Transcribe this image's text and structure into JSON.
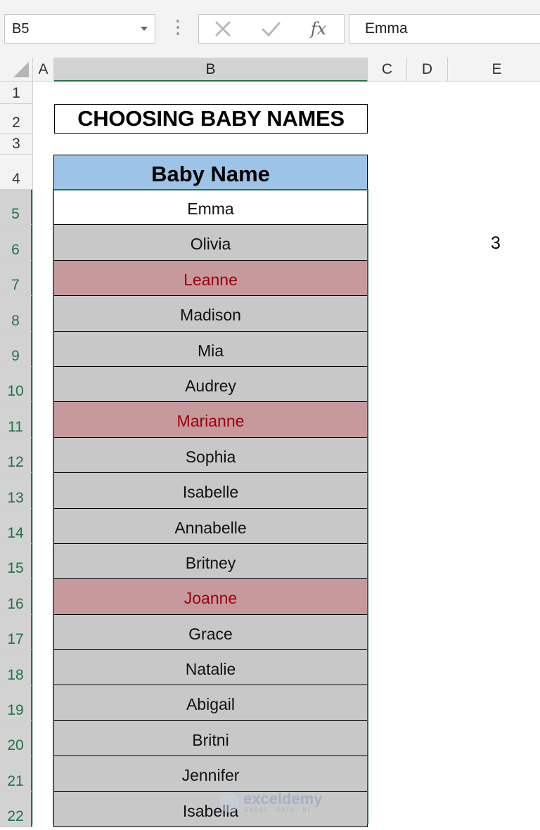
{
  "formula_bar": {
    "name_box": "B5",
    "cancel_symbol": "✕",
    "enter_symbol": "✓",
    "fx_label": "fx",
    "value": "Emma"
  },
  "columns": [
    "A",
    "B",
    "C",
    "D",
    "E"
  ],
  "rows": [
    "1",
    "2",
    "3",
    "4",
    "5",
    "6",
    "7",
    "8",
    "9",
    "10",
    "11",
    "12",
    "13",
    "14",
    "15",
    "16",
    "17",
    "18",
    "19",
    "20",
    "21",
    "22"
  ],
  "sheet": {
    "title": "CHOOSING BABY NAMES",
    "header": "Baby Name",
    "names": [
      {
        "name": "Emma",
        "duplicate": false,
        "active": true
      },
      {
        "name": "Olivia",
        "duplicate": false
      },
      {
        "name": "Leanne",
        "duplicate": true
      },
      {
        "name": "Madison",
        "duplicate": false
      },
      {
        "name": "Mia",
        "duplicate": false
      },
      {
        "name": "Audrey",
        "duplicate": false
      },
      {
        "name": "Marianne",
        "duplicate": true
      },
      {
        "name": "Sophia",
        "duplicate": false
      },
      {
        "name": "Isabelle",
        "duplicate": false
      },
      {
        "name": "Annabelle",
        "duplicate": false
      },
      {
        "name": "Britney",
        "duplicate": false
      },
      {
        "name": "Joanne",
        "duplicate": true
      },
      {
        "name": "Grace",
        "duplicate": false
      },
      {
        "name": "Natalie",
        "duplicate": false
      },
      {
        "name": "Abigail",
        "duplicate": false
      },
      {
        "name": "Britni",
        "duplicate": false
      },
      {
        "name": "Jennifer",
        "duplicate": false
      },
      {
        "name": "Isabella",
        "duplicate": false
      }
    ],
    "e6_value": "3"
  },
  "colors": {
    "header_fill": "#9dc3e6",
    "row_fill": "#c8c8c8",
    "duplicate_fill": "#c6999d",
    "duplicate_text": "#9c0006",
    "selection": "#217346"
  },
  "watermark": {
    "name": "exceldemy",
    "tagline": "EXCEL · DATA · BI"
  }
}
